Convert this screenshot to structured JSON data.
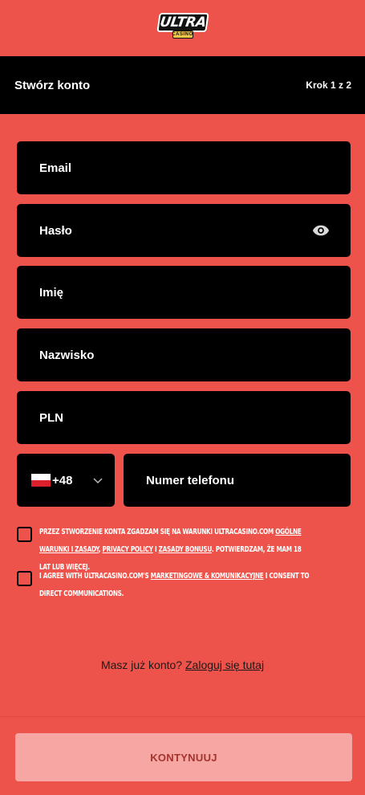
{
  "logo": {
    "word": "ULTRA",
    "sub": "CASINO"
  },
  "header": {
    "title": "Stwórz konto",
    "step": "Krok 1 z 2"
  },
  "fields": {
    "email": "Email",
    "password": "Hasło",
    "first_name": "Imię",
    "last_name": "Nazwisko",
    "currency": "PLN"
  },
  "phone": {
    "code": "+48",
    "placeholder": "Numer telefonu",
    "flag": "poland-flag-icon"
  },
  "consent_terms": {
    "t1": "Przez stworzenie konta zgadzam się na warunki ultracasino.com ",
    "link1": "ogólne warunki i zasady",
    "t2": ", ",
    "link2": "privacy policy",
    "t3": " i ",
    "link3": "zasady bonusu",
    "t4": ". Potwierdzam, że mam 18 lat lub więcej."
  },
  "consent_marketing": {
    "t1": "I agree with ultracasino.com's ",
    "link1": "marketingowe & komunikacyjne",
    "t2": " I consent to direct communications."
  },
  "login": {
    "text": "Masz już konto? ",
    "link": "Zaloguj się tutaj"
  },
  "submit": {
    "label": "KONTYNUUJ"
  },
  "colors": {
    "background": "#ee534b",
    "field": "#000000",
    "button": "#f6a7a3",
    "button_text": "#a5332d"
  }
}
